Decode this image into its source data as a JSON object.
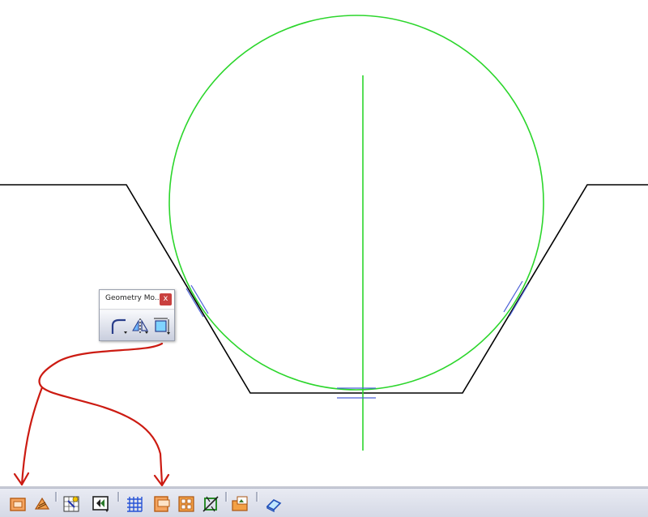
{
  "geometry_panel": {
    "title": "Geometry Mo...",
    "close_label": "x",
    "tools": [
      "fillet-icon",
      "mirror-icon",
      "constraint-box-icon"
    ]
  },
  "bottom_toolbar": {
    "icons": [
      "sketch-frame-icon",
      "hatch-tool-icon",
      "grid-snap-icon",
      "window-pan-icon",
      "grid-icon",
      "layer-frame-icon",
      "multi-view-icon",
      "cut-tool-icon",
      "image-import-icon",
      "eraser-tool-icon"
    ]
  },
  "colors": {
    "circle": "#2cd62c",
    "profile": "#000000",
    "constraint_marks": "#4a5fd6",
    "annotation": "#cc1b12"
  }
}
